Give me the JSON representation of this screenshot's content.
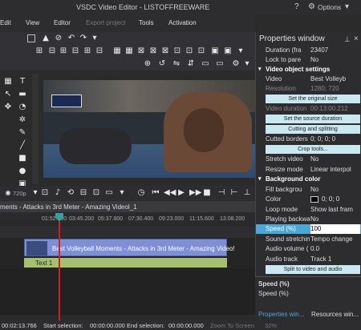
{
  "window": {
    "title": "VSDC Video Editor - LISTOFFREEWARE",
    "options_label": "Options"
  },
  "menu": {
    "edit": "Edit",
    "view": "View",
    "editor": "Editor",
    "export": "Export project",
    "tools": "Tools",
    "activation": "Activation"
  },
  "player": {
    "zoom": "720p"
  },
  "timeline": {
    "tab_label": "ments - Attacks in 3rd Meter - Amazing Videol_1",
    "ticks": [
      "01:52.200",
      "03:45.200",
      "05:37.800",
      "07:30.400",
      "09:23.000",
      "11:15.600",
      "13:08.200"
    ],
    "clip_label": "Best Volleyball Moments - Attacks in 3rd Meter - Amazing Video!",
    "text_clip_label": "Text 1"
  },
  "status": {
    "time": "00:02:13.766",
    "start_label": "Start selection:",
    "start_value": "00:00:00.000",
    "end_label": "End selection:",
    "end_value": "00:00:00.000",
    "zoom_label": "Zoom To Screen",
    "zoom_value": "32%"
  },
  "properties": {
    "title": "Properties window",
    "rows_top": [
      {
        "k": "Duration (fra",
        "v": "23407"
      },
      {
        "k": "Lock to pare",
        "v": "No"
      }
    ],
    "section_video": "Video object settings",
    "video_row": {
      "k": "Video",
      "v": "Best Volleyb"
    },
    "resolution": {
      "k": "Resolution",
      "v": "1280; 720"
    },
    "btn_original": "Set the original size",
    "video_duration": {
      "k": "Video duration",
      "v": "00:13:00.212"
    },
    "btn_source": "Set the source duration",
    "btn_cut": "Cutting and splitting",
    "cutted": {
      "k": "Cutted borders",
      "v": "0; 0; 0; 0"
    },
    "btn_crop": "Crop tools...",
    "stretch": {
      "k": "Stretch video",
      "v": "No"
    },
    "resize": {
      "k": "Resize mode",
      "v": "Linear interpol"
    },
    "section_bg": "Background color",
    "fill": {
      "k": "Fill backgrou",
      "v": "No"
    },
    "color": {
      "k": "Color",
      "v": "0; 0; 0"
    },
    "loop": {
      "k": "Loop mode",
      "v": "Show last fram"
    },
    "playing": {
      "k": "Playing backwa",
      "v": "No"
    },
    "speed": {
      "k": "Speed (%)",
      "v": "100"
    },
    "sound": {
      "k": "Sound stretchin",
      "v": "Tempo change"
    },
    "audio_vol": {
      "k": "Audio volume (",
      "v": "0.0"
    },
    "audio_track": {
      "k": "Audio track",
      "v": "Track 1"
    },
    "btn_split": "Split to video and audio",
    "desc_title": "Speed (%)",
    "desc_text": "Speed (%)",
    "tab_properties": "Properties win...",
    "tab_resources": "Resources win..."
  }
}
